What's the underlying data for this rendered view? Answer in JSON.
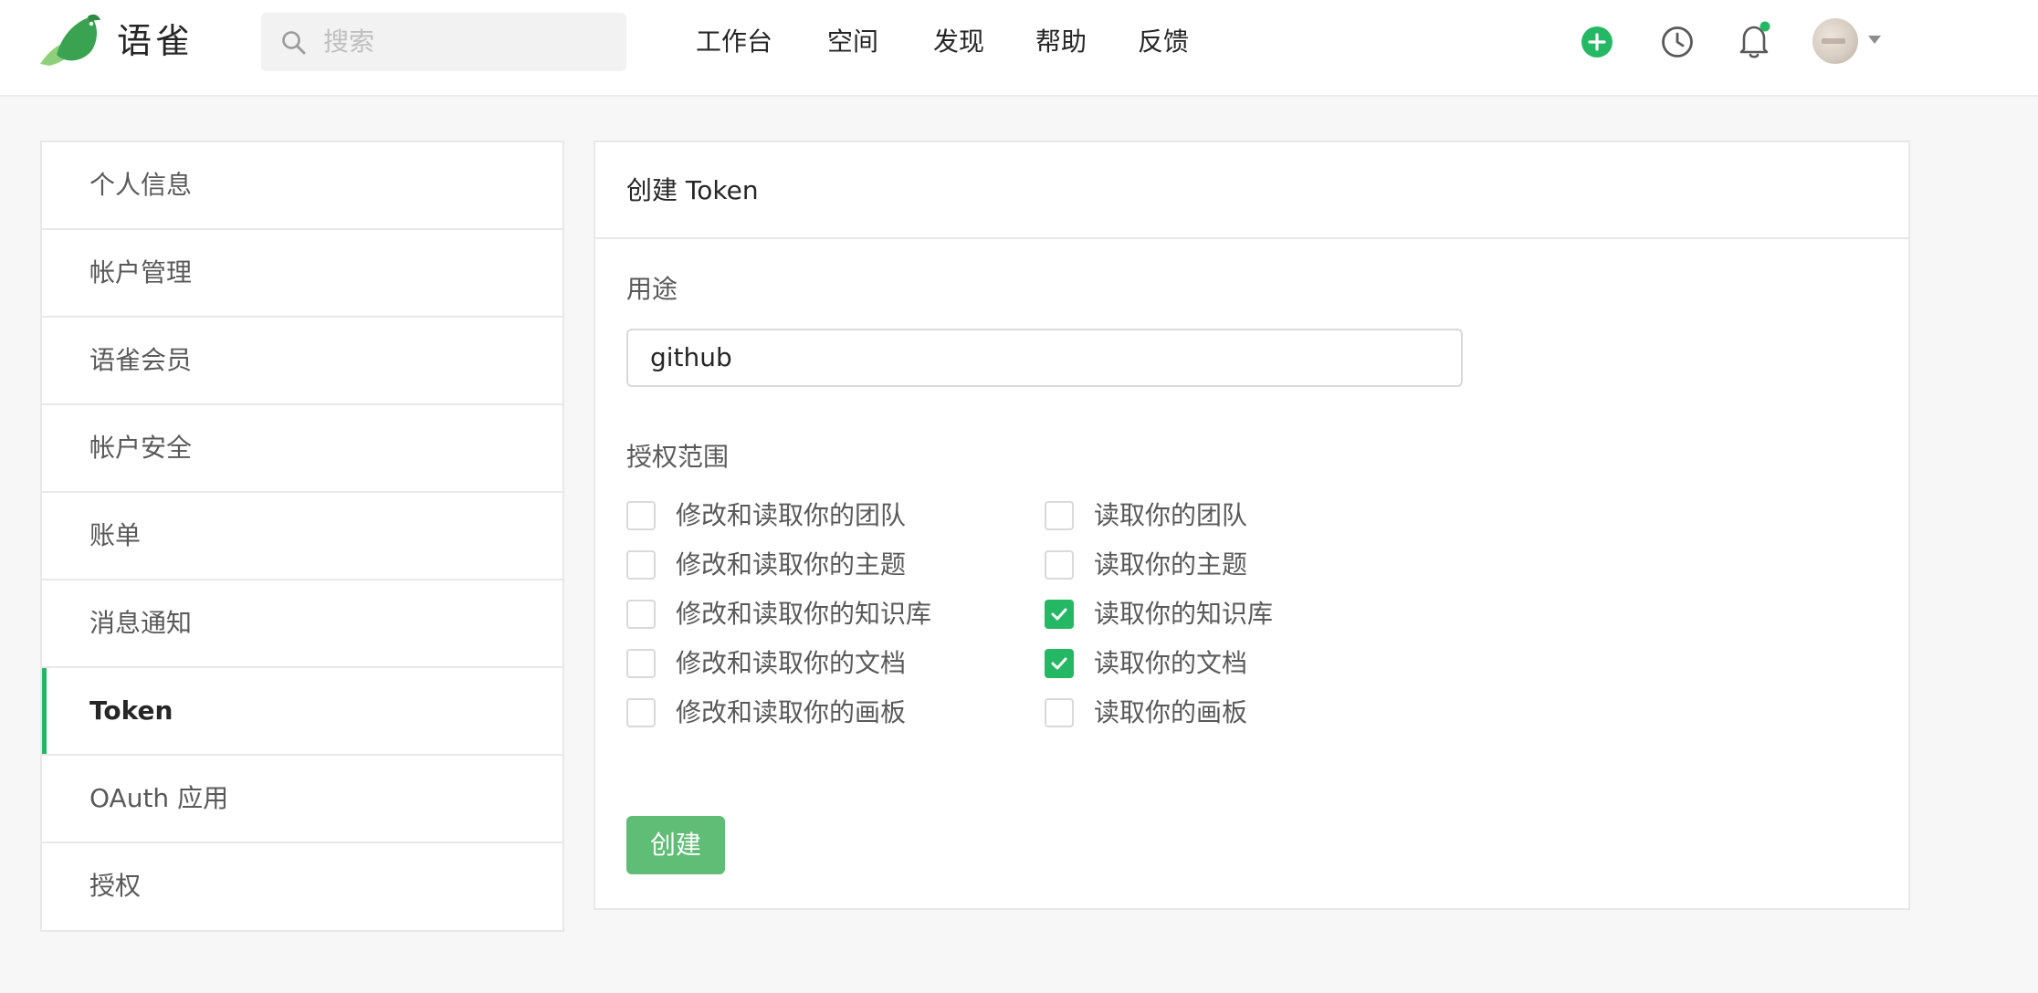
{
  "header": {
    "brand": "语雀",
    "search_placeholder": "搜索",
    "nav": [
      "工作台",
      "空间",
      "发现",
      "帮助",
      "反馈"
    ]
  },
  "sidebar": {
    "items": [
      {
        "label": "个人信息",
        "active": false
      },
      {
        "label": "帐户管理",
        "active": false
      },
      {
        "label": "语雀会员",
        "active": false
      },
      {
        "label": "帐户安全",
        "active": false
      },
      {
        "label": "账单",
        "active": false
      },
      {
        "label": "消息通知",
        "active": false
      },
      {
        "label": "Token",
        "active": true
      },
      {
        "label": "OAuth 应用",
        "active": false
      },
      {
        "label": "授权",
        "active": false
      }
    ]
  },
  "form": {
    "title": "创建 Token",
    "usage_label": "用途",
    "usage_value": "github",
    "scope_label": "授权范围",
    "scopes_write": [
      {
        "label": "修改和读取你的团队",
        "checked": false
      },
      {
        "label": "修改和读取你的主题",
        "checked": false
      },
      {
        "label": "修改和读取你的知识库",
        "checked": false
      },
      {
        "label": "修改和读取你的文档",
        "checked": false
      },
      {
        "label": "修改和读取你的画板",
        "checked": false
      }
    ],
    "scopes_read": [
      {
        "label": "读取你的团队",
        "checked": false
      },
      {
        "label": "读取你的主题",
        "checked": false
      },
      {
        "label": "读取你的知识库",
        "checked": true
      },
      {
        "label": "读取你的文档",
        "checked": true
      },
      {
        "label": "读取你的画板",
        "checked": false
      }
    ],
    "submit_label": "创建"
  },
  "colors": {
    "accent": "#25b864",
    "button": "#5fbd75",
    "notification_dot": "#25b864"
  },
  "icons": {
    "logo": "yuque-bird-logo",
    "search": "search-icon",
    "add": "plus-circle-icon",
    "history": "clock-icon",
    "notifications": "bell-icon",
    "caret": "caret-down-icon"
  }
}
